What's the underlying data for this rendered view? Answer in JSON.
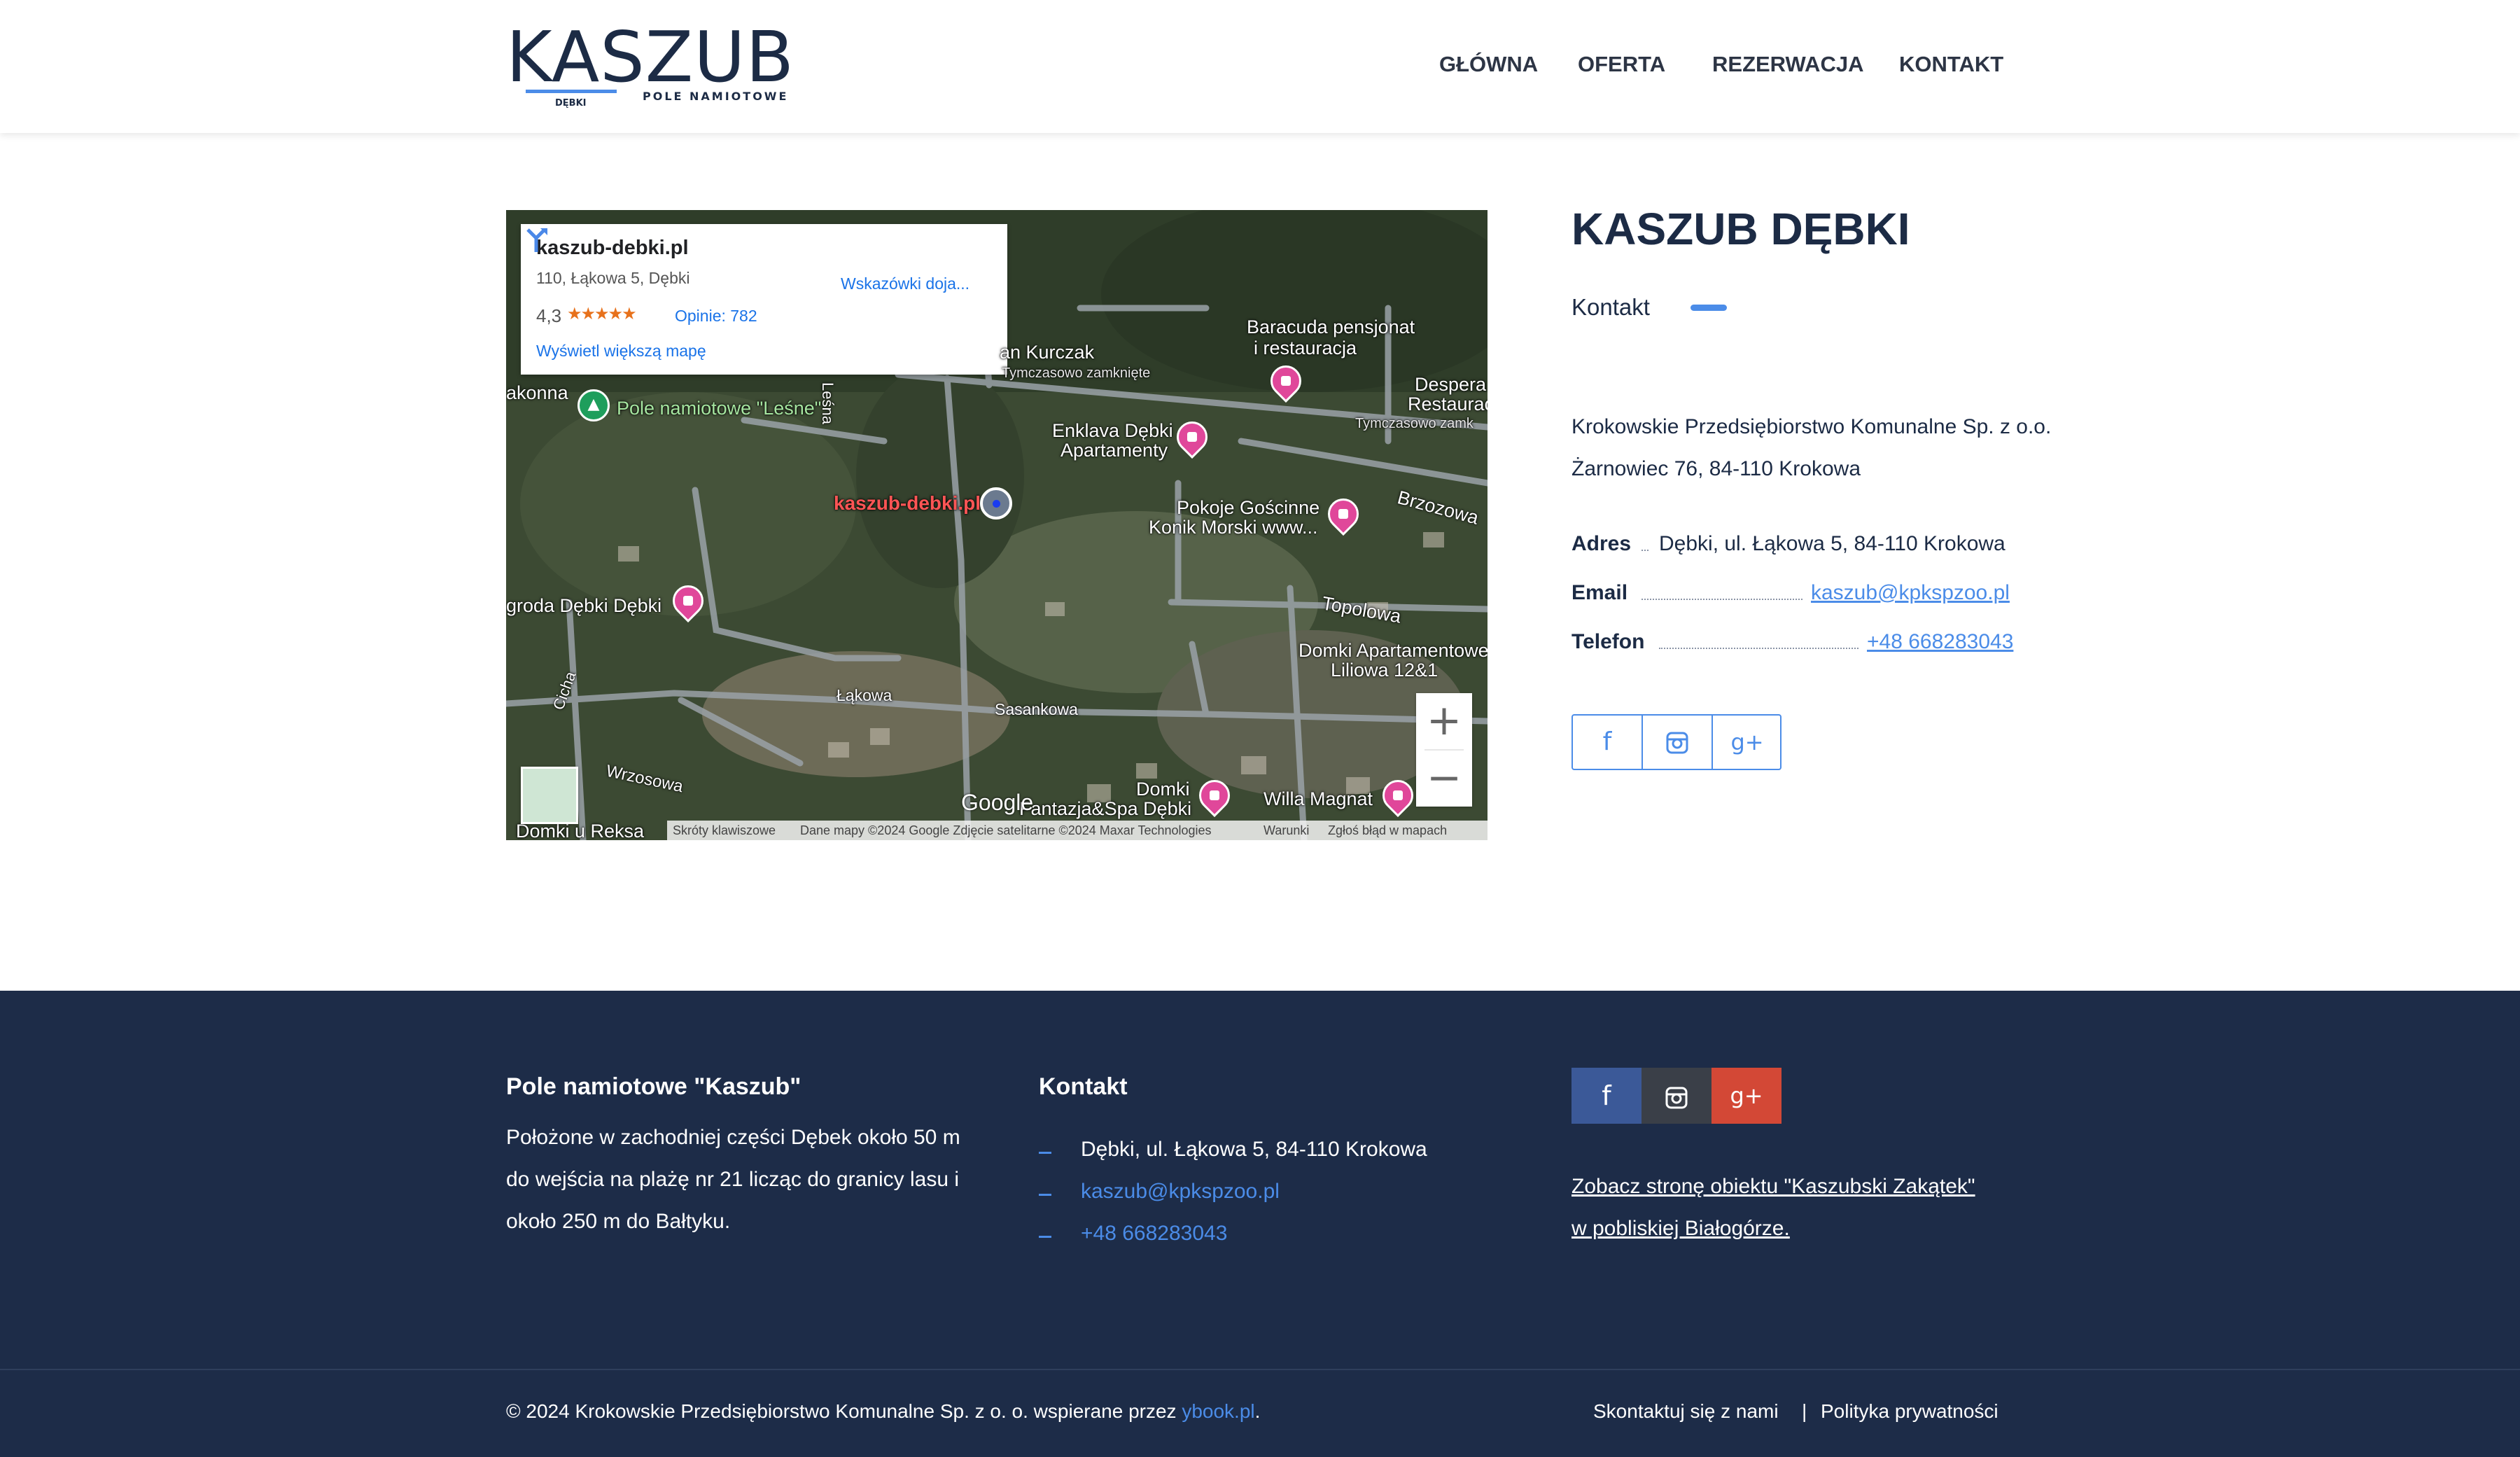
{
  "header": {
    "logo_word": "KASZUB",
    "logo_sub1": "DĘBKI",
    "logo_sub2": "POLE NAMIOTOWE",
    "nav": [
      "GŁÓWNA",
      "OFERTA",
      "REZERWACJA",
      "KONTAKT"
    ]
  },
  "map": {
    "infobox": {
      "title": "kaszub-debki.pl",
      "address": "110, Łąkowa 5, Dębki",
      "rating": "4,3",
      "stars": "★★★★★",
      "reviews": "Opinie: 782",
      "bigger_map": "Wyświetl większą mapę",
      "directions": "Wskazówki doja..."
    },
    "labels": {
      "kurczak": "an Kurczak",
      "kurczak_status": "Tymczasowo zamknięte",
      "baracuda": "Baracuda pensjonat",
      "baracuda2": "i restauracja",
      "desperado": "Despera",
      "desperado2": "Restauracja D",
      "desperado_status": "Tymczasowo zamk",
      "akonna": "akonna",
      "lesne": "Pole namiotowe \"Leśne\"",
      "lesna": "Leśna",
      "enklava": "Enklava Dębki",
      "enklava2": "Apartamenty",
      "kaszub": "kaszub-debki.pl",
      "konik": "Pokoje Gościnne",
      "konik2": "Konik Morski www...",
      "brzozowa": "Brzozowa",
      "zagroda": "groda Dębki Dębki",
      "topolowa": "Topolowa",
      "domki_ap": "Domki Apartamentowe",
      "domki_ap2": "Liliowa 12&1",
      "lakowa": "Łąkowa",
      "sasankowa": "Sasankowa",
      "cicha": "Cicha",
      "wrzosowa": "Wrzosowa",
      "fantazja": "Domki",
      "fantazja2": "Fantazja&Spa Dębki",
      "willa": "Willa Magnat",
      "reksa": "Domki u Reksa",
      "google": "Google"
    },
    "zoom_in": "+",
    "zoom_out": "−",
    "attribution": {
      "shortcuts": "Skróty klawiszowe",
      "data": "Dane mapy ©2024 Google Zdjęcie satelitarne ©2024 Maxar Technologies",
      "terms": "Warunki",
      "report": "Zgłoś błąd w mapach"
    }
  },
  "info": {
    "title": "KASZUB DĘBKI",
    "subtitle": "Kontakt",
    "company_line1": "Krokowskie Przedsiębiorstwo Komunalne Sp. z o.o.",
    "company_line2": "Żarnowiec 76, 84-110 Krokowa",
    "address_label": "Adres",
    "address_value": "Dębki, ul. Łąkowa 5, 84-110 Krokowa",
    "email_label": "Email",
    "email_value": "kaszub@kpkspzoo.pl",
    "phone_label": "Telefon",
    "phone_value": "+48 668283043",
    "social_icons": [
      "facebook-icon",
      "instagram-icon",
      "google-plus-icon"
    ]
  },
  "footer": {
    "about_heading": "Pole namiotowe \"Kaszub\"",
    "about_text": "Położone w zachodniej części Dębek około 50 m do wejścia na plażę nr 21 licząc do granicy lasu i około 250 m do Bałtyku.",
    "contact_heading": "Kontakt",
    "contact_address": "Dębki, ul. Łąkowa 5, 84-110 Krokowa",
    "contact_email": "kaszub@kpkspzoo.pl",
    "contact_phone": "+48 668283043",
    "promo_line1": "Zobacz stronę obiektu \"Kaszubski Zakątek\"",
    "promo_line2": "w pobliskiej Białogórze.",
    "copyright": "© 2024 Krokowskie Przedsiębiorstwo Komunalne Sp. z o. o. wspierane przez",
    "copyright_link": "ybook.pl",
    "copyright_end": ".",
    "link_contact": "Skontaktuj się z nami",
    "pipe": "|",
    "link_privacy": "Polityka prywatności",
    "colors": {
      "background": "#1d2c48",
      "facebook": "#3b5998",
      "instagram": "#3a3f48",
      "google_plus": "#d34836",
      "accent": "#4b8ce8"
    }
  }
}
